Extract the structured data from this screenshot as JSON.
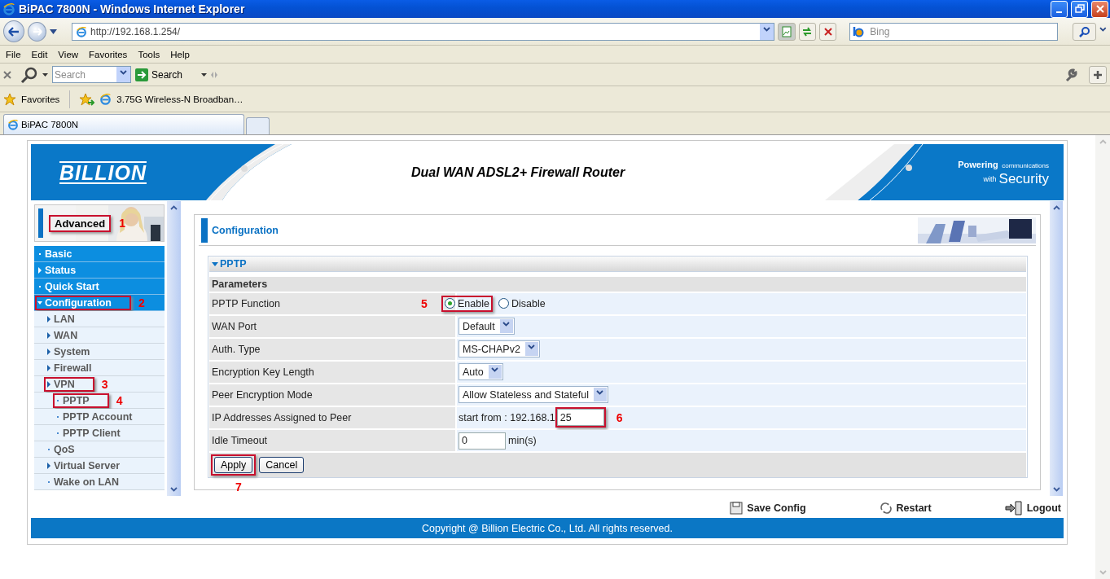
{
  "window": {
    "title": "BiPAC 7800N - Windows Internet Explorer"
  },
  "address_bar": {
    "url": "http://192.168.1.254/",
    "search_placeholder": "Bing"
  },
  "menu": [
    "File",
    "Edit",
    "View",
    "Favorites",
    "Tools",
    "Help"
  ],
  "toolbar": {
    "search_placeholder": "Search",
    "search_button": "Search"
  },
  "favorites_bar": {
    "label": "Favorites",
    "links": [
      "3.75G Wireless-N Broadban…"
    ]
  },
  "tabs": [
    {
      "label": "BiPAC 7800N",
      "selected": true
    }
  ],
  "router": {
    "brand": "BILLION",
    "title": "Dual WAN ADSL2+ Firewall Router",
    "slogan": [
      "Powering",
      "communications",
      "with",
      "Security"
    ],
    "mode": {
      "label": "Advanced",
      "marker": "1"
    },
    "sidebar": [
      {
        "label": "Basic",
        "kind": "bullet"
      },
      {
        "label": "Status",
        "kind": "arrow",
        "expanded": false
      },
      {
        "label": "Quick Start",
        "kind": "bullet"
      },
      {
        "label": "Configuration",
        "kind": "arrow",
        "expanded": true,
        "marker": "2",
        "children": [
          {
            "label": "LAN",
            "kind": "arrow",
            "expanded": false
          },
          {
            "label": "WAN",
            "kind": "arrow",
            "expanded": false
          },
          {
            "label": "System",
            "kind": "arrow",
            "expanded": false
          },
          {
            "label": "Firewall",
            "kind": "arrow",
            "expanded": false
          },
          {
            "label": "VPN",
            "kind": "arrow",
            "expanded": false,
            "marker": "3",
            "children": [
              {
                "label": "PPTP",
                "kind": "bullet",
                "marker": "4"
              },
              {
                "label": "PPTP Account",
                "kind": "bullet"
              },
              {
                "label": "PPTP Client",
                "kind": "bullet"
              }
            ]
          },
          {
            "label": "QoS",
            "kind": "bullet"
          },
          {
            "label": "Virtual Server",
            "kind": "arrow",
            "expanded": false
          },
          {
            "label": "Wake on LAN",
            "kind": "bullet"
          }
        ]
      }
    ],
    "section_title": "Configuration",
    "panel": {
      "title": "PPTP",
      "subtitle": "Parameters",
      "rows": [
        {
          "label": "PPTP Function",
          "kind": "radio",
          "options": [
            {
              "label": "Enable",
              "selected": true,
              "marker": "5"
            },
            {
              "label": "Disable",
              "selected": false
            }
          ]
        },
        {
          "label": "WAN Port",
          "kind": "select",
          "value": "Default"
        },
        {
          "label": "Auth. Type",
          "kind": "select",
          "value": "MS-CHAPv2"
        },
        {
          "label": "Encryption Key Length",
          "kind": "select",
          "value": "Auto"
        },
        {
          "label": "Peer Encryption Mode",
          "kind": "select",
          "value": "Allow Stateless and Stateful"
        },
        {
          "label": "IP Addresses Assigned to Peer",
          "kind": "ip",
          "prefix": "start from : 192.168.1",
          "value": "25",
          "marker": "6"
        },
        {
          "label": "Idle Timeout",
          "kind": "input",
          "value": "0",
          "unit": "min(s)"
        }
      ],
      "buttons": [
        {
          "label": "Apply",
          "marker": "7"
        },
        {
          "label": "Cancel"
        }
      ]
    },
    "footer_links": [
      {
        "label": "Save Config",
        "kind": "save"
      },
      {
        "label": "Restart",
        "kind": "restart"
      },
      {
        "label": "Logout",
        "kind": "logout"
      }
    ],
    "copyright": "Copyright @ Billion Electric Co., Ltd. All rights reserved."
  }
}
